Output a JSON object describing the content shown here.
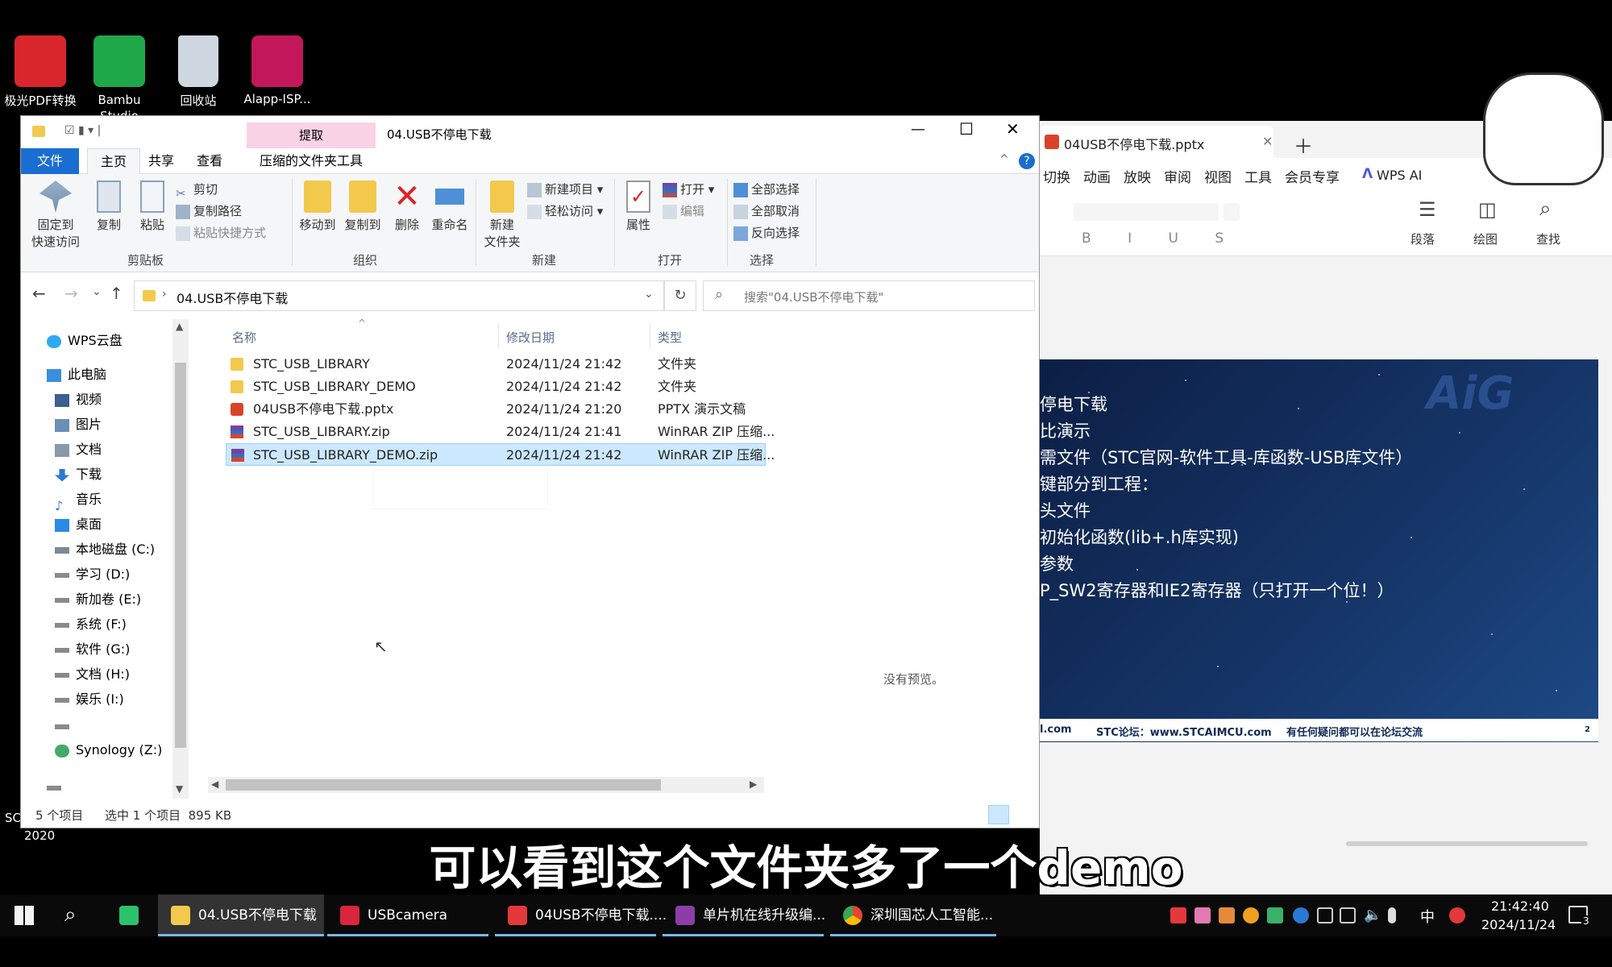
{
  "desktop": {
    "icons": [
      {
        "label": "极光PDF转换器",
        "color": "#d9262c"
      },
      {
        "label": "Bambu Studio",
        "color": "#1fa84a"
      },
      {
        "label": "回收站",
        "color": "#cfd8e0"
      },
      {
        "label": "Alapp-ISP...",
        "color": "#c2185b"
      }
    ],
    "left_fragments": [
      "SC",
      "2020"
    ]
  },
  "explorer": {
    "title": "04.USB不停电下载",
    "context_tab": "提取",
    "tabs": [
      "文件",
      "主页",
      "共享",
      "查看",
      "压缩的文件夹工具"
    ],
    "ribbon": {
      "clipboard": {
        "label": "剪贴板",
        "pin": "固定到\n快速访问",
        "pin_l1": "固定到",
        "pin_l2": "快速访问",
        "copy": "复制",
        "paste": "粘贴",
        "cut": "剪切",
        "copy_path": "复制路径",
        "paste_shortcut": "粘贴快捷方式"
      },
      "organize": {
        "label": "组织",
        "move_to": "移动到",
        "copy_to": "复制到",
        "delete": "删除",
        "rename": "重命名"
      },
      "new": {
        "label": "新建",
        "new_folder_l1": "新建",
        "new_folder_l2": "文件夹",
        "new_item": "新建项目",
        "easy_access": "轻松访问"
      },
      "open": {
        "label": "打开",
        "properties": "属性",
        "open": "打开",
        "edit": "编辑"
      },
      "select": {
        "label": "选择",
        "select_all": "全部选择",
        "select_none": "全部取消",
        "invert": "反向选择"
      }
    },
    "address": {
      "path": "04.USB不停电下载",
      "search_placeholder": "搜索\"04.USB不停电下载\""
    },
    "nav": [
      {
        "label": "WPS云盘",
        "color": "#2ea8f2"
      },
      {
        "label": "此电脑",
        "color": "#3b8ee0"
      },
      {
        "label": "视频",
        "color": "#3a5f90"
      },
      {
        "label": "图片",
        "color": "#6c8fb5"
      },
      {
        "label": "文档",
        "color": "#8899aa"
      },
      {
        "label": "下载",
        "color": "#2a78d6"
      },
      {
        "label": "音乐",
        "color": "#2a78d6"
      },
      {
        "label": "桌面",
        "color": "#2a8be6"
      },
      {
        "label": "本地磁盘 (C:)",
        "color": "#7a8a99"
      },
      {
        "label": "学习 (D:)",
        "color": "#8a8a8a"
      },
      {
        "label": "新加卷 (E:)",
        "color": "#8a8a8a"
      },
      {
        "label": "系统 (F:)",
        "color": "#8a8a8a"
      },
      {
        "label": "软件 (G:)",
        "color": "#8a8a8a"
      },
      {
        "label": "文档 (H:)",
        "color": "#8a8a8a"
      },
      {
        "label": "娱乐 (I:)",
        "color": "#8a8a8a"
      },
      {
        "label": "Synology (Z:)",
        "color": "#44aa66"
      }
    ],
    "columns": {
      "name": "名称",
      "date": "修改日期",
      "type": "类型"
    },
    "files": [
      {
        "name": "STC_USB_LIBRARY",
        "date": "2024/11/24 21:42",
        "type": "文件夹",
        "icon": "folder-icon",
        "selected": false
      },
      {
        "name": "STC_USB_LIBRARY_DEMO",
        "date": "2024/11/24 21:42",
        "type": "文件夹",
        "icon": "folder-icon",
        "selected": false
      },
      {
        "name": "04USB不停电下载.pptx",
        "date": "2024/11/24 21:20",
        "type": "PPTX 演示文稿",
        "icon": "pptx-icon",
        "selected": false
      },
      {
        "name": "STC_USB_LIBRARY.zip",
        "date": "2024/11/24 21:41",
        "type": "WinRAR ZIP 压缩...",
        "icon": "winrar-icon",
        "selected": false
      },
      {
        "name": "STC_USB_LIBRARY_DEMO.zip",
        "date": "2024/11/24 21:42",
        "type": "WinRAR ZIP 压缩...",
        "icon": "winrar-icon",
        "selected": true
      }
    ],
    "preview_text": "没有预览。",
    "status": {
      "count": "5 个项目",
      "selected": "选中 1 个项目  895 KB"
    }
  },
  "wps": {
    "tab_title": "04USB不停电下载.pptx",
    "menu": [
      "切换",
      "动画",
      "放映",
      "审阅",
      "视图",
      "工具",
      "会员专享",
      "WPS AI"
    ],
    "toolbar": {
      "paragraph": "段落",
      "draw": "绘图",
      "find": "查找"
    },
    "slide": {
      "lines": [
        "停电下载",
        "比演示",
        "需文件（STC官网-软件工具-库函数-USB库文件）",
        "键部分到工程：",
        "头文件",
        "初始化函数(lib+.h库实现)",
        "参数",
        "P_SW2寄存器和IE2寄存器（只打开一个位！）"
      ],
      "logo": "AiG",
      "footer_left": "l.com",
      "footer_mid": "STC论坛：www.STCAIMCU.com",
      "footer_right": "有任何疑问都可以在论坛交流",
      "page": "2"
    }
  },
  "subtitle": "可以看到这个文件夹多了一个demo",
  "taskbar": {
    "items": [
      {
        "label": "04.USB不停电下载",
        "color": "#f2c94c",
        "active": true
      },
      {
        "label": "USBcamera",
        "color": "#d9263c",
        "active": false
      },
      {
        "label": "04USB不停电下载....",
        "color": "#e5383b",
        "active": false
      },
      {
        "label": "单片机在线升级编...",
        "color": "#8e3da8",
        "active": false
      },
      {
        "label": "深圳国芯人工智能...",
        "color": "#34a853",
        "active": false
      }
    ],
    "ime": "中",
    "time": "21:42:40",
    "date": "2024/11/24",
    "notification_count": "3"
  }
}
